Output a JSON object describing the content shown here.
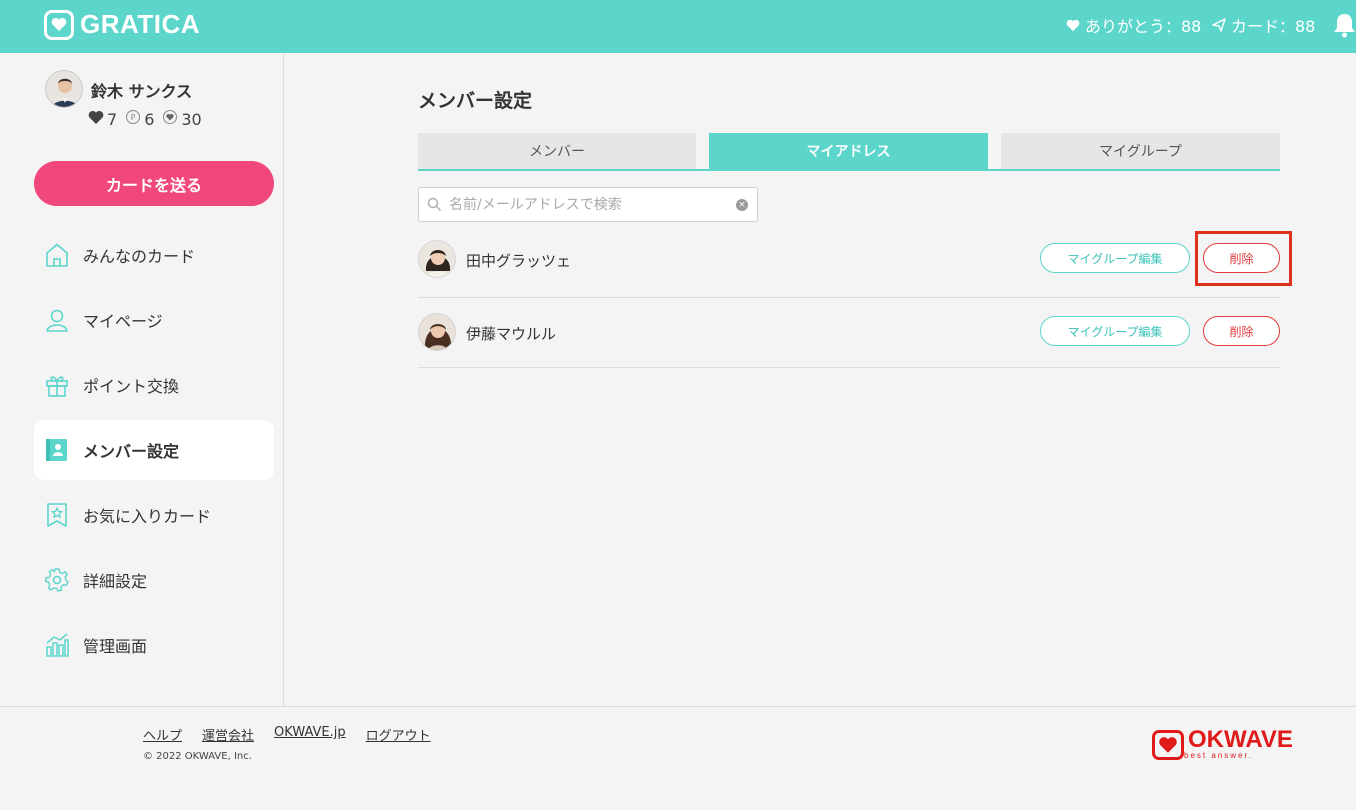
{
  "header": {
    "app_name": "GRATICA",
    "thanks_label": "ありがとう：88",
    "cards_label": "カード：88"
  },
  "user": {
    "name": "鈴木 サンクス",
    "hearts": "7",
    "points": "6",
    "badges": "30"
  },
  "sidebar": {
    "send_button": "カードを送る",
    "items": [
      {
        "label": "みんなのカード",
        "icon": "home-icon"
      },
      {
        "label": "マイページ",
        "icon": "person-icon"
      },
      {
        "label": "ポイント交換",
        "icon": "gift-icon"
      },
      {
        "label": "メンバー設定",
        "icon": "contact-book-icon",
        "active": true
      },
      {
        "label": "お気に入りカード",
        "icon": "bookmark-star-icon"
      },
      {
        "label": "詳細設定",
        "icon": "gear-icon"
      },
      {
        "label": "管理画面",
        "icon": "chart-icon"
      }
    ]
  },
  "main": {
    "title": "メンバー設定",
    "tabs": [
      {
        "label": "メンバー"
      },
      {
        "label": "マイアドレス",
        "active": true
      },
      {
        "label": "マイグループ"
      }
    ],
    "search": {
      "placeholder": "名前/メールアドレスで検索",
      "value": ""
    },
    "members": [
      {
        "name": "田中グラッツェ",
        "edit_label": "マイグループ編集",
        "delete_label": "削除"
      },
      {
        "name": "伊藤マウルル",
        "edit_label": "マイグループ編集",
        "delete_label": "削除"
      }
    ]
  },
  "footer": {
    "links": [
      "ヘルプ",
      "運営会社",
      "OKWAVE.jp",
      "ログアウト"
    ],
    "copyright": "© 2022 OKWAVE, Inc.",
    "brand": "OKWAVE",
    "brand_tagline": "best answer."
  },
  "colors": {
    "accent": "#5cd5cb",
    "primary_button": "#f0487a",
    "danger": "#e03a3a",
    "highlight_box": "#e0301e"
  }
}
